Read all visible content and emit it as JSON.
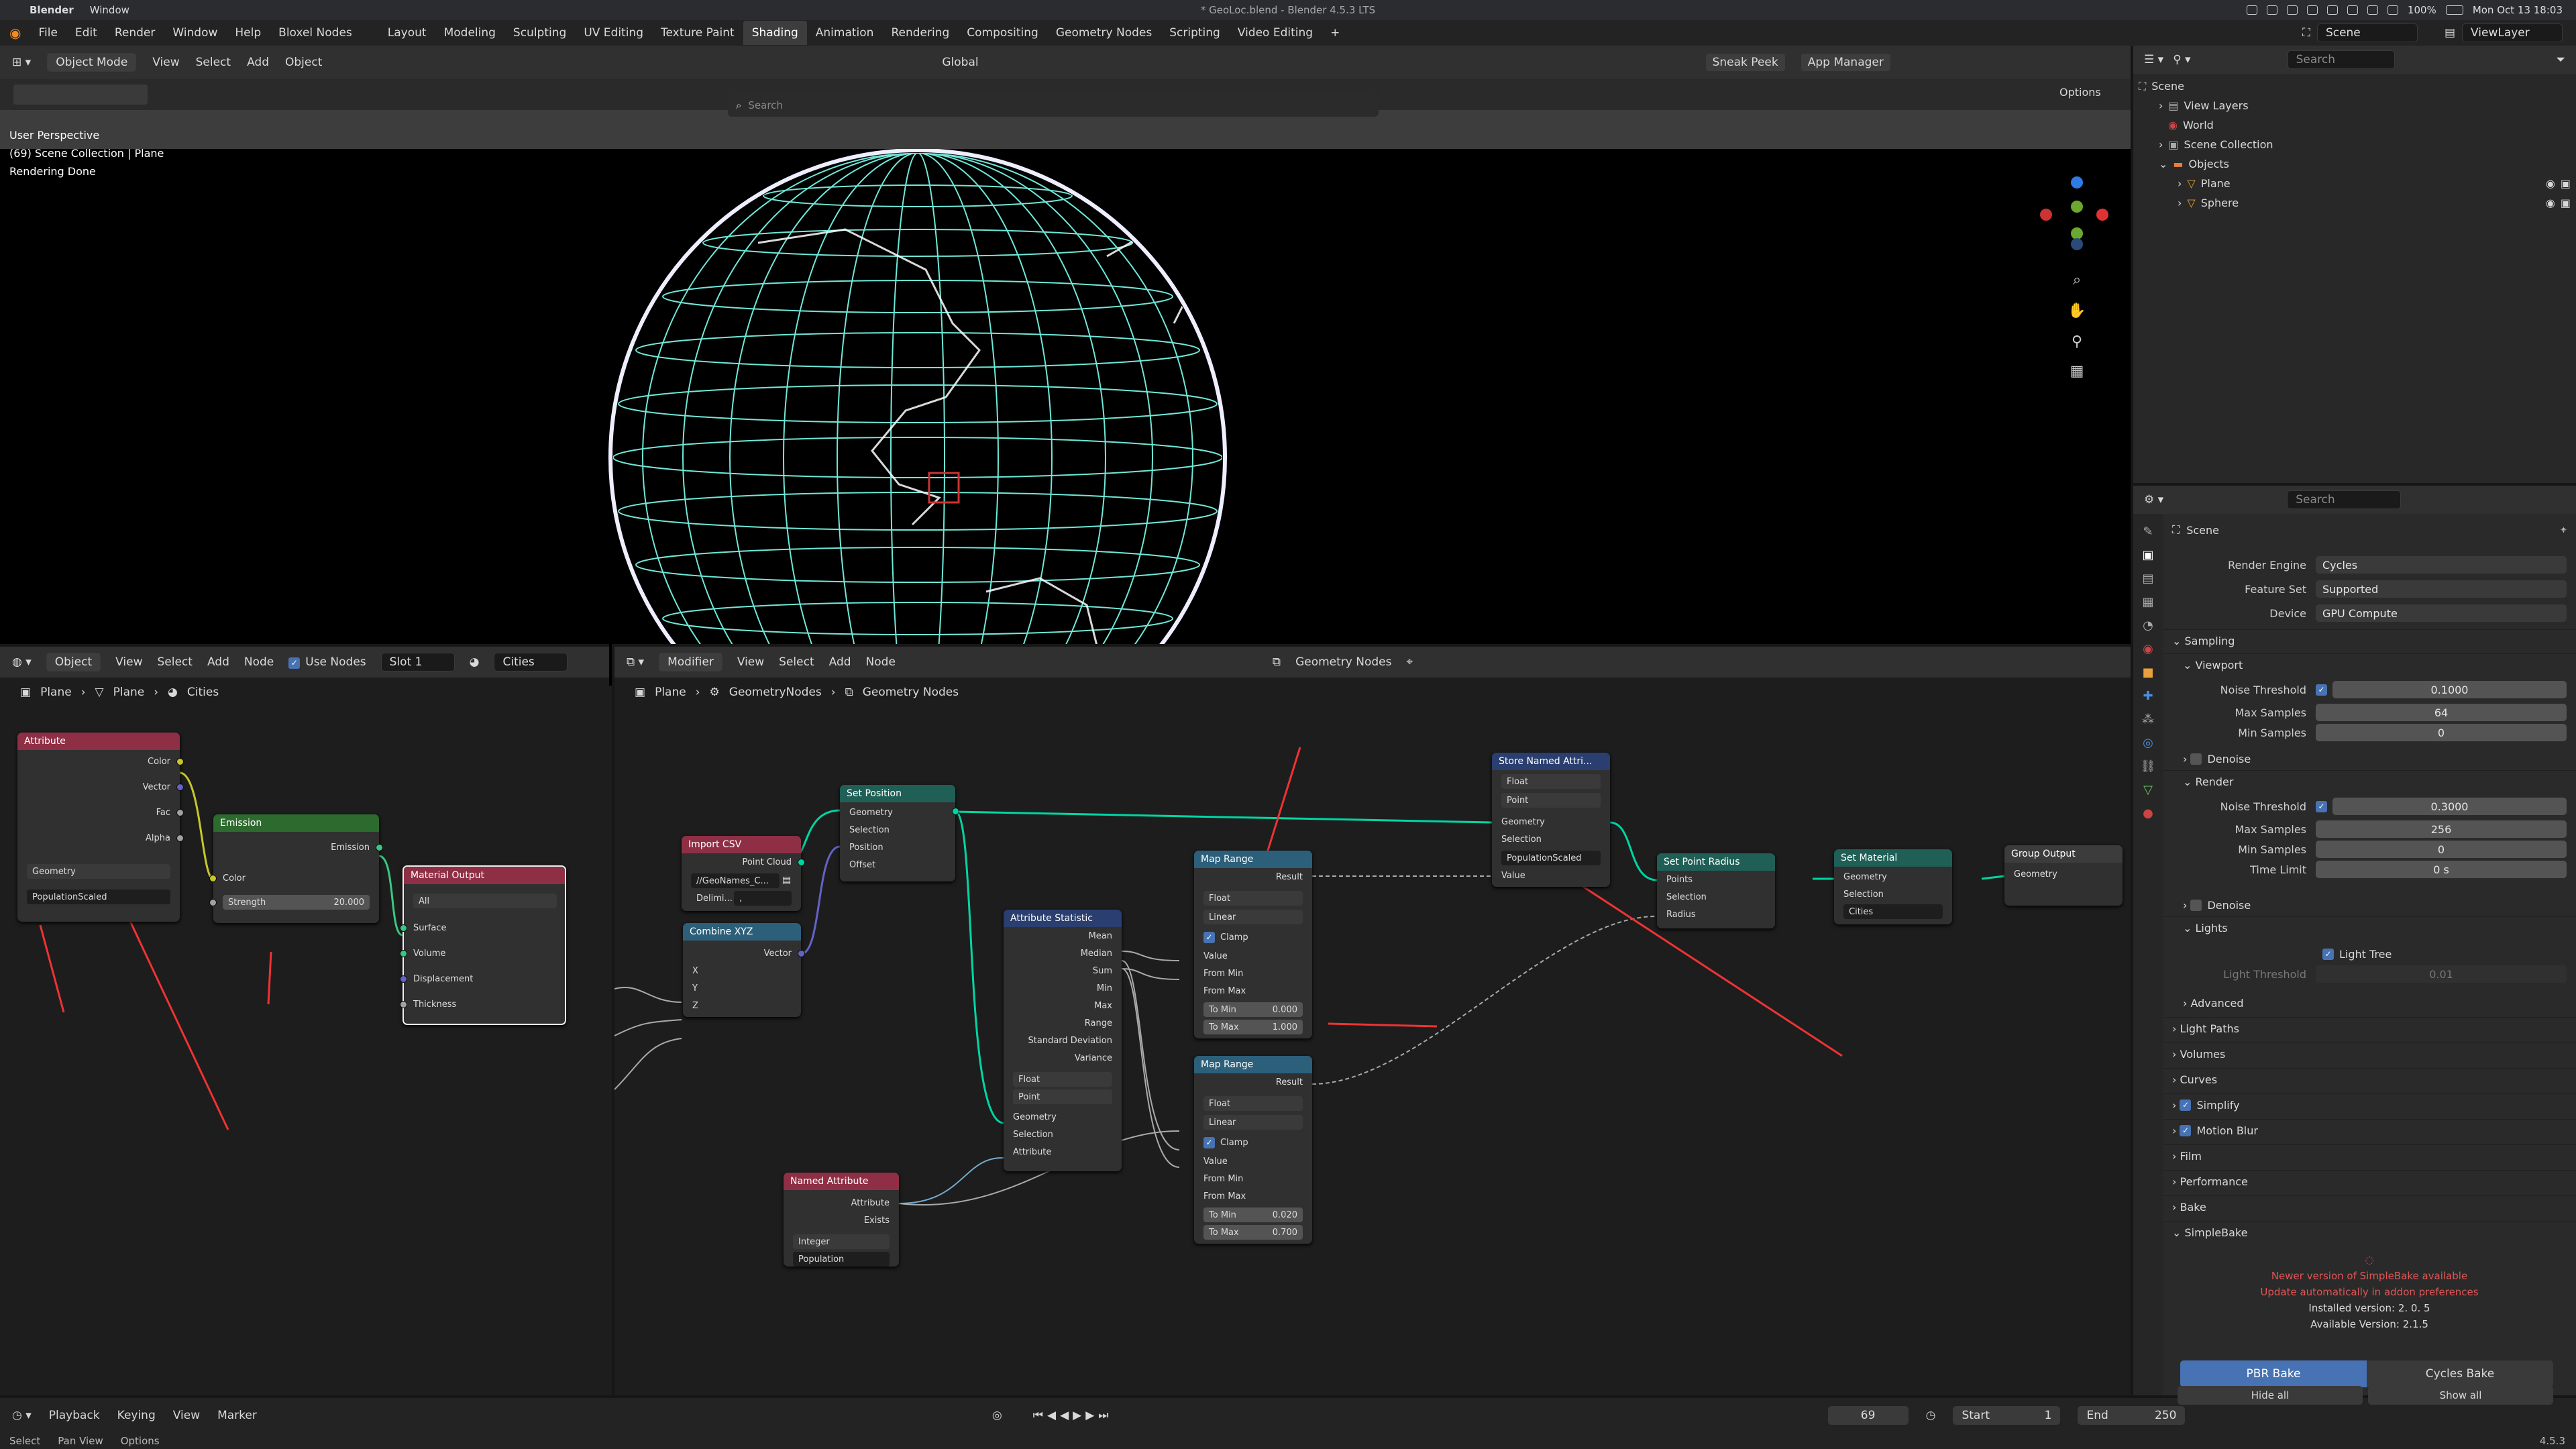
{
  "mac": {
    "app": "Blender",
    "menu_window": "Window",
    "title": "* GeoLoc.blend - Blender 4.5.3 LTS",
    "battery": "100%",
    "datetime": "Mon Oct 13 18:03"
  },
  "menu": [
    "File",
    "Edit",
    "Render",
    "Window",
    "Help",
    "Bloxel Nodes"
  ],
  "workspaces": [
    "Layout",
    "Modeling",
    "Sculpting",
    "UV Editing",
    "Texture Paint",
    "Shading",
    "Animation",
    "Rendering",
    "Compositing",
    "Geometry Nodes",
    "Scripting",
    "Video Editing"
  ],
  "active_workspace": "Shading",
  "scene_name": "Scene",
  "view_layer": "ViewLayer",
  "viewport": {
    "mode": "Object Mode",
    "menus": [
      "View",
      "Select",
      "Add",
      "Object"
    ],
    "orientation": "Global",
    "search_placeholder": "Search",
    "options": "Options",
    "sneak_peek": "Sneak Peek",
    "app_manager": "App Manager",
    "info": [
      "User Perspective",
      "(69) Scene Collection | Plane",
      "Rendering Done"
    ]
  },
  "outliner": {
    "search_placeholder": "Search",
    "rows": [
      {
        "label": "Scene",
        "indent": 0
      },
      {
        "label": "View Layers",
        "indent": 1
      },
      {
        "label": "World",
        "indent": 1
      },
      {
        "label": "Scene Collection",
        "indent": 1
      },
      {
        "label": "Objects",
        "indent": 1
      },
      {
        "label": "Plane",
        "indent": 2
      },
      {
        "label": "Sphere",
        "indent": 2
      }
    ]
  },
  "props": {
    "search_placeholder": "Search",
    "context": "Scene",
    "render_engine": {
      "label": "Render Engine",
      "value": "Cycles"
    },
    "feature_set": {
      "label": "Feature Set",
      "value": "Supported"
    },
    "device": {
      "label": "Device",
      "value": "GPU Compute"
    },
    "sampling": "Sampling",
    "viewport": "Viewport",
    "vp_noise": {
      "label": "Noise Threshold",
      "value": "0.1000"
    },
    "vp_max": {
      "label": "Max Samples",
      "value": "64"
    },
    "vp_min": {
      "label": "Min Samples",
      "value": "0"
    },
    "denoise": "Denoise",
    "render": "Render",
    "r_noise": {
      "label": "Noise Threshold",
      "value": "0.3000"
    },
    "r_max": {
      "label": "Max Samples",
      "value": "256"
    },
    "r_min": {
      "label": "Min Samples",
      "value": "0"
    },
    "r_time": {
      "label": "Time Limit",
      "value": "0 s"
    },
    "lights": "Lights",
    "light_tree": "Light Tree",
    "light_threshold": {
      "label": "Light Threshold",
      "value": "0.01"
    },
    "advanced": "Advanced",
    "light_paths": "Light Paths",
    "volumes": "Volumes",
    "curves": "Curves",
    "simplify": "Simplify",
    "motion_blur": "Motion Blur",
    "film": "Film",
    "performance": "Performance",
    "bake": "Bake",
    "simplebake": "SimpleBake",
    "sb_msg1": "Newer version of SimpleBake available",
    "sb_msg2": "Update automatically in addon preferences",
    "sb_installed": "Installed version: 2. 0. 5",
    "sb_available": "Available Version: 2.1.5",
    "pbr_bake": "PBR Bake",
    "cycles_bake": "Cycles Bake",
    "hide_all": "Hide all",
    "show_all": "Show all"
  },
  "shader": {
    "object": "Object",
    "menus": [
      "View",
      "Select",
      "Add",
      "Node"
    ],
    "use_nodes": "Use Nodes",
    "slot": "Slot 1",
    "material": "Cities",
    "crumbs": [
      "Plane",
      "Plane",
      "Cities"
    ],
    "attribute": {
      "title": "Attribute",
      "outputs": [
        "Color",
        "Vector",
        "Fac",
        "Alpha"
      ],
      "type": "Geometry",
      "name": "PopulationScaled"
    },
    "emission": {
      "title": "Emission",
      "output": "Emission",
      "color": "Color",
      "strength_label": "Strength",
      "strength": "20.000"
    },
    "matout": {
      "title": "Material Output",
      "target": "All",
      "inputs": [
        "Surface",
        "Volume",
        "Displacement",
        "Thickness"
      ]
    }
  },
  "geo": {
    "mode": "Modifier",
    "menus": [
      "View",
      "Select",
      "Add",
      "Node"
    ],
    "tree": "Geometry Nodes",
    "crumbs": [
      "Plane",
      "GeometryNodes",
      "Geometry Nodes"
    ],
    "import_csv": {
      "title": "Import CSV",
      "out": "Point Cloud",
      "path": "//GeoNames_C...",
      "delim": "Delimi..."
    },
    "combine": {
      "title": "Combine XYZ",
      "out": "Vector",
      "ins": [
        "X",
        "Y",
        "Z"
      ]
    },
    "setpos": {
      "title": "Set Position",
      "out": "Geometry",
      "ins": [
        "Geometry",
        "Selection",
        "Position",
        "Offset"
      ]
    },
    "named": {
      "title": "Named Attribute",
      "outs": [
        "Attribute",
        "Exists"
      ],
      "type": "Integer",
      "name": "Population"
    },
    "stat": {
      "title": "Attribute Statistic",
      "outs": [
        "Mean",
        "Median",
        "Sum",
        "Min",
        "Max",
        "Range",
        "Standard Deviation",
        "Variance"
      ],
      "type": "Float",
      "domain": "Point",
      "ins": [
        "Geometry",
        "Selection",
        "Attribute"
      ]
    },
    "mr1": {
      "title": "Map Range",
      "out": "Result",
      "type": "Float",
      "interp": "Linear",
      "clamp": "Clamp",
      "ins": [
        "Value",
        "From Min",
        "From Max"
      ],
      "tomin_l": "To Min",
      "tomin": "0.000",
      "tomax_l": "To Max",
      "tomax": "1.000"
    },
    "mr2": {
      "title": "Map Range",
      "out": "Result",
      "type": "Float",
      "interp": "Linear",
      "clamp": "Clamp",
      "ins": [
        "Value",
        "From Min",
        "From Max"
      ],
      "tomin_l": "To Min",
      "tomin": "0.020",
      "tomax_l": "To Max",
      "tomax": "0.700"
    },
    "store": {
      "title": "Store Named Attri...",
      "type": "Float",
      "domain": "Point",
      "ins": [
        "Geometry",
        "Selection"
      ],
      "name": "PopulationScaled",
      "value": "Value"
    },
    "radius": {
      "title": "Set Point Radius",
      "ins": [
        "Points",
        "Selection",
        "Radius"
      ]
    },
    "setmat": {
      "title": "Set Material",
      "out": "Geometry",
      "ins": [
        "Geometry",
        "Selection"
      ],
      "mat": "Cities"
    },
    "gout": {
      "title": "Group Output",
      "in": "Geometry"
    }
  },
  "timeline": {
    "menus": [
      "Playback",
      "Keying",
      "View",
      "Marker"
    ],
    "frame": "69",
    "start_l": "Start",
    "start": "1",
    "end_l": "End",
    "end": "250"
  },
  "status": {
    "items": [
      "Select",
      "Pan View",
      "Options"
    ],
    "version": "4.5.3"
  }
}
